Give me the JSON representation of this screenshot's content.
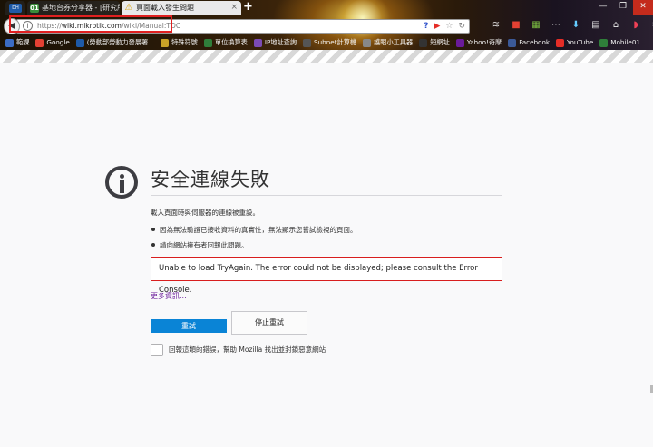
{
  "tabs": {
    "pinned": {
      "icon_text": "DH"
    },
    "tab1": {
      "label": "基地台券分享器 - [研究所] ...",
      "icon_text": "01"
    },
    "tab2": {
      "label": "頁面載入發生問題",
      "icon": "warning-icon"
    },
    "new_tab": "+"
  },
  "window_controls": {
    "minimize": "—",
    "maximize": "❐",
    "close": "✕"
  },
  "urlbar": {
    "prefix": "https://",
    "domain": "wiki.mikrotik.com",
    "path": "/wiki/Manual:TOC"
  },
  "bookmarks": [
    {
      "label": "範課",
      "color": "#3b6cc4"
    },
    {
      "label": "Google",
      "color": "#e34133"
    },
    {
      "label": "(勞動部勞動力發展署...",
      "color": "#1e5aa8"
    },
    {
      "label": "特殊符號",
      "color": "#c9a227"
    },
    {
      "label": "單位換算表",
      "color": "#2f7f3a"
    },
    {
      "label": "IP地址查詢",
      "color": "#7b4bb5"
    },
    {
      "label": "Subnet計算機",
      "color": "#555555"
    },
    {
      "label": "護眼小工具器",
      "color": "#888888"
    },
    {
      "label": "短網址",
      "color": "#333333"
    },
    {
      "label": "Yahoo!奇摩",
      "color": "#6a1b9a"
    },
    {
      "label": "Facebook",
      "color": "#3b5998"
    },
    {
      "label": "YouTube",
      "color": "#e52d27"
    },
    {
      "label": "Mobile01",
      "color": "#2f7f3a"
    }
  ],
  "error": {
    "title": "安全連線失敗",
    "description": "載入頁面時與伺服器的連線被重設。",
    "bullets": [
      "因為無法驗證已接收資料的真實性，無法顯示您嘗試檢視的頁面。",
      "請向網站擁有者回報此問題。"
    ],
    "console_message": "Unable to load TryAgain. The error could not be displayed; please consult the Error Console.",
    "more_info": "更多資訊...",
    "retry_label": "重試",
    "stop_label": "停止重試",
    "report_label": "回報這類的錯誤，幫助 Mozilla 找出並封鎖惡意網站"
  },
  "colors": {
    "primary_button": "#0a84d6",
    "highlight_border": "#d81e1e",
    "link": "#6a1b9a"
  }
}
